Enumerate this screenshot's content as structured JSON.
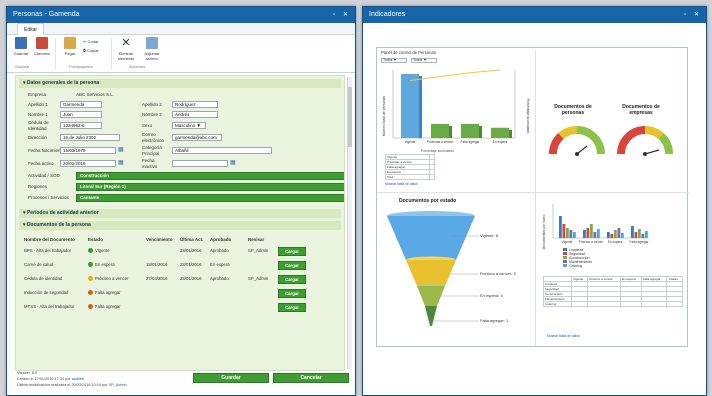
{
  "left_window": {
    "title": "Personas - Gamenda",
    "controls": "▫ ✕",
    "ribbon_tab": "Editar",
    "ribbon_buttons": [
      {
        "label": "Guardar",
        "icon": "save-icon"
      },
      {
        "label": "Cancelar",
        "icon": "cancel-icon"
      },
      {
        "label": "Pegar",
        "icon": "paste-icon"
      },
      {
        "label": "Cortar",
        "icon": "cut-icon"
      },
      {
        "label": "Copiar",
        "icon": "copy-icon"
      },
      {
        "label": "Eliminar elemento",
        "icon": "delete-icon"
      },
      {
        "label": "Adjuntar archivo",
        "icon": "attach-icon"
      }
    ],
    "ribbon_groups": [
      "Guardar",
      "Portapapeles",
      "Acciones"
    ],
    "section_general": "Datos generales de la persona",
    "fields": {
      "empresa_label": "Empresa",
      "empresa_value": "ABC Servicios S.L.",
      "apellido1_label": "Apellido 1",
      "apellido1_value": "Garmenda",
      "apellido2_label": "Apellido 2",
      "apellido2_value": "Rodríguez",
      "nombre1_label": "Nombre 1",
      "nombre1_value": "Juan",
      "nombre2_label": "Nombre 2",
      "nombre2_value": "Andrés",
      "cedula_label": "Cédula de Identidad",
      "cedula_value": "1234562-6",
      "sexo_label": "Sexo",
      "sexo_value": "Masculino ▼",
      "direccion_label": "Dirección",
      "direccion_value": "18 de Julio 2302",
      "correo_label": "Correo electrónico",
      "correo_value": "garmenda@abc.com",
      "nacimiento_label": "Fecha Nacimiento",
      "nacimiento_value": "15/03/1979",
      "categoria_label": "Categoría Principal",
      "categoria_value": "Albañil",
      "activo_label": "Fecha activo",
      "activo_value": "20/01/2016",
      "inactivo_label": "Fecha inactivo",
      "inactivo_value": "",
      "actividad_label": "Actividad / SOD",
      "actividad_value": "Construcción",
      "regiones_label": "Regiones",
      "regiones_value": "Litoral Sur (Región 1)",
      "procesos_label": "Procesos / Servicios",
      "procesos_value": "Cantante"
    },
    "section_periodos": "Períodos de actividad anterior",
    "section_docs": "Documentos de la persona",
    "doc_headers": [
      "Nombre del Documento",
      "Estado",
      "Vencimiento",
      "Última Act.",
      "Aprobado",
      "Revisar"
    ],
    "documents": [
      {
        "name": "BPS - Alta del trabajador",
        "status": "Vigente",
        "color": "#3a9a2a",
        "venc": "",
        "ult": "28/01/2016",
        "aprob": "Aprobado",
        "rev": "SP_Admin",
        "btn": "Cargar"
      },
      {
        "name": "Carné de salud",
        "status": "En espera",
        "color": "#3a9a2a",
        "venc": "18/01/2016",
        "ult": "28/01/2016",
        "aprob": "En espera",
        "rev": "",
        "btn": "Cargar"
      },
      {
        "name": "Cédula de identidad",
        "status": "Próximo a vencer",
        "color": "#e2b400",
        "venc": "27/03/2016",
        "ult": "28/01/2016",
        "aprob": "Aprobado",
        "rev": "SP_Admin",
        "btn": "Cargar"
      },
      {
        "name": "Inducción de seguridad",
        "status": "Falta agregar",
        "color": "#e05a1a",
        "venc": "",
        "ult": "",
        "aprob": "",
        "rev": "",
        "btn": "Cargar"
      },
      {
        "name": "MTSS - Alta del trabajador",
        "status": "Falta agregar",
        "color": "#e05a1a",
        "venc": "",
        "ult": "",
        "aprob": "",
        "rev": "",
        "btn": "Cargar"
      }
    ],
    "footer": {
      "version": "Versión: 8.0",
      "created": "Creado el 17/01/2016 17:34 por",
      "created_by": "audiles",
      "modified": "Última modificación realizada el 20/03/2016 10:19 por",
      "modified_by": "SP_Admin"
    },
    "save_btn": "Guardar",
    "cancel_btn": "Cancelar"
  },
  "right_window": {
    "title": "Indicadores",
    "controls": "▫ ✕",
    "dashboard_title": "Panel de control de Personas",
    "filters": [
      "Todos ▼",
      "Todos ▼"
    ],
    "pareto": {
      "ylabel_left": "Número total de personas",
      "ylabel_right": "Porcentaje acumulado",
      "categories": [
        "Vigente",
        "Próximas a vencer",
        "Falta agregar",
        "En espera"
      ],
      "bar_color": "#5fa8df",
      "line_color": "#f2c531",
      "legend": "Porcentaje acumulado",
      "table_rows": [
        "Vigente",
        "Próximas a vencer",
        "Falta agregar",
        "En espera",
        "Total"
      ],
      "link": "Mostrar tabla de datos"
    },
    "gauges": [
      {
        "title": "Documentos de personas"
      },
      {
        "title": "Documentos de empresas"
      }
    ],
    "funnel": {
      "title": "Documentos por estado",
      "labels": [
        "Vigente: 8",
        "Próximo a vencer: 3",
        "En espera: 4",
        "Falta agregar: 1"
      ],
      "colors": [
        "#5aa9e6",
        "#e9c12e",
        "#9bb84a",
        "#4a8a3a"
      ]
    },
    "grouped": {
      "ylabel": "Documentos por rubro",
      "categories": [
        "Vigente",
        "Próximo a vencer",
        "En espera",
        "Falta agregar"
      ],
      "series": [
        "Limpieza",
        "Seguridad",
        "Construcción",
        "Mantenimiento",
        "Catering"
      ],
      "colors": [
        "#3b78c2",
        "#d9453b",
        "#77b04b",
        "#8e5fb0",
        "#3fb1c9"
      ],
      "table_headers": [
        "",
        "Vigente",
        "Próximo a vencer",
        "En espera",
        "Falta agregar",
        "Totales"
      ],
      "table_rows": [
        "Limpieza",
        "Seguridad",
        "Construcción",
        "Mantenimiento",
        "Catering"
      ],
      "link": "Mostrar tabla de datos"
    }
  }
}
